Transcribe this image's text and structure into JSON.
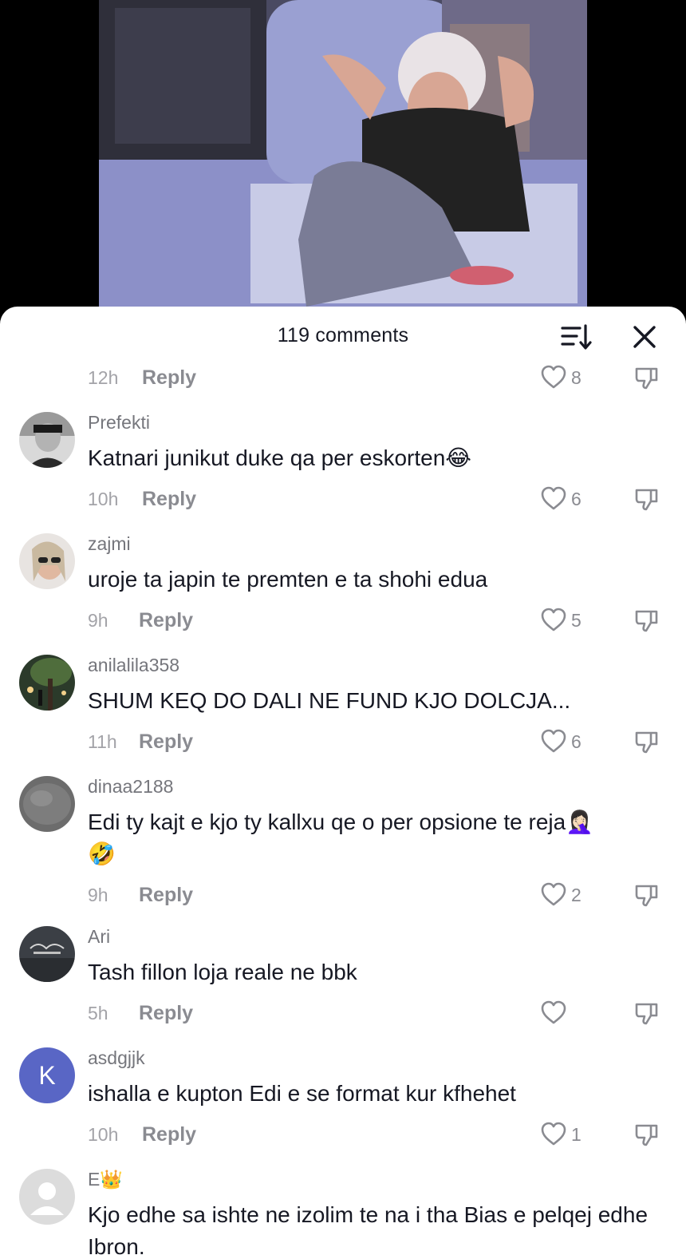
{
  "video": {
    "description_icon": "video-frame"
  },
  "sheet": {
    "title": "119 comments",
    "sort_icon": "sort-icon",
    "close_icon": "close-icon"
  },
  "top_meta": {
    "time": "12h",
    "reply": "Reply",
    "likes": "8"
  },
  "comments": [
    {
      "username": "Prefekti",
      "text": "Katnari junikut duke qa per eskorten",
      "emoji": "😂",
      "time": "10h",
      "reply": "Reply",
      "likes": "6",
      "avatar": "photo"
    },
    {
      "username": "zajmi",
      "text": "uroje ta japin te premten e ta shohi edua",
      "emoji": "",
      "time": "9h",
      "reply": "Reply",
      "likes": "5",
      "avatar": "photo"
    },
    {
      "username": "anilalila358",
      "text": "SHUM KEQ DO DALI NE FUND KJO DOLCJA...",
      "emoji": "",
      "time": "11h",
      "reply": "Reply",
      "likes": "6",
      "avatar": "photo"
    },
    {
      "username": "dinaa2188",
      "text": "Edi ty kajt e kjo ty kallxu qe o per opsione te reja",
      "emoji": "🤦🏻‍♀️",
      "text2_emoji": "🤣",
      "time": "9h",
      "reply": "Reply",
      "likes": "2",
      "avatar": "photo"
    },
    {
      "username": "Ari",
      "text": "Tash fillon loja reale ne bbk",
      "emoji": "",
      "time": "5h",
      "reply": "Reply",
      "likes": "",
      "avatar": "photo"
    },
    {
      "username": "asdgjjk",
      "text": "ishalla e kupton Edi e se format kur kfhehet",
      "emoji": "",
      "time": "10h",
      "reply": "Reply",
      "likes": "1",
      "avatar": "K"
    },
    {
      "username": "E",
      "username_emoji": "👑",
      "text": "Kjo edhe sa ishte ne izolim te na i tha Bias e pelqej edhe Ibron.",
      "emoji": "",
      "avatar": "default"
    }
  ],
  "colors": {
    "accent_avatar": "#5966c5",
    "text": "#161823",
    "muted": "#8a8b91"
  }
}
